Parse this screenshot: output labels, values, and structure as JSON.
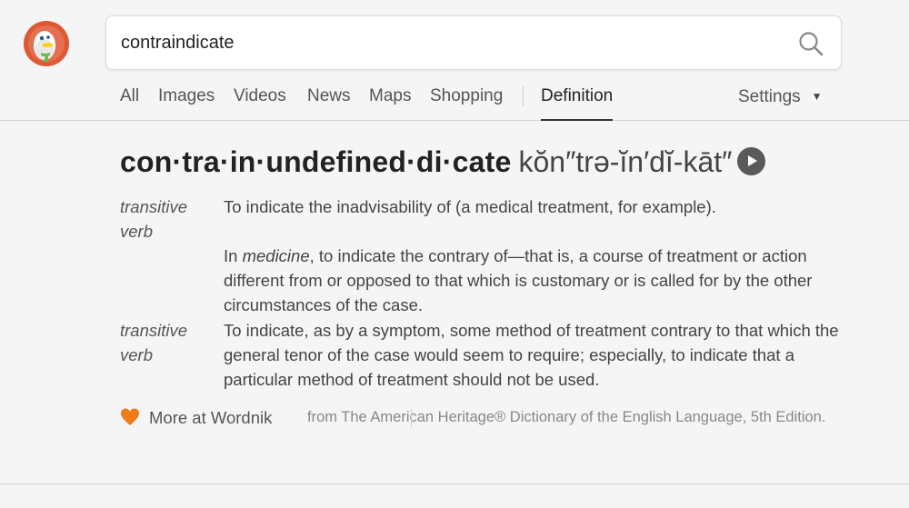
{
  "search": {
    "query": "contraindicate",
    "icon": "search-icon"
  },
  "nav": {
    "tabs": [
      {
        "label": "All"
      },
      {
        "label": "Images"
      },
      {
        "label": "Videos"
      },
      {
        "label": "News"
      },
      {
        "label": "Maps"
      },
      {
        "label": "Shopping"
      },
      {
        "label": "Definition",
        "active": true
      }
    ],
    "settings_label": "Settings",
    "settings_caret": "▼"
  },
  "definition": {
    "headword": "con·tra·in·undefined·di·cate",
    "pronunciation": "kŏn″trə-ĭn′dĭ-kāt″",
    "senses": [
      {
        "pos": "transitive verb",
        "text": "To indicate the inadvisability of (a medical treatment, for example)."
      },
      {
        "pos": "",
        "text_before": "In ",
        "text_em": "medicine",
        "text_after": ", to indicate the contrary of—that is, a course of treatment or action different from or opposed to that which is customary or is called for by the other circumstances of the case."
      },
      {
        "pos": "transitive verb",
        "text": "To indicate, as by a symptom, some method of treatment contrary to that which the general tenor of the case would seem to require; especially, to indicate that a particular method of treatment should not be used."
      }
    ]
  },
  "footer": {
    "more_label": "More at Wordnik",
    "attribution": "from The American Heritage® Dictionary of the English Language, 5th Edition.",
    "heart_color": "#f07b1b"
  },
  "colors": {
    "logo_orange": "#de5833",
    "audio_button": "#5a5a5a"
  }
}
